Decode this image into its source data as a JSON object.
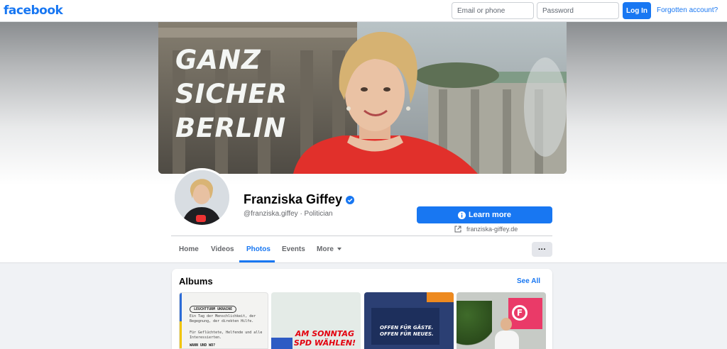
{
  "header": {
    "logo": "facebook",
    "email_placeholder": "Email or phone",
    "password_placeholder": "Password",
    "login_label": "Log In",
    "forgot_label": "Forgotten account?"
  },
  "cover": {
    "slogan_lines": [
      "GANZ",
      "SICHER",
      "BERLIN"
    ]
  },
  "profile": {
    "name": "Franziska Giffey",
    "verified": true,
    "handle_line": "@franziska.giffey · Politician",
    "cta_label": "Learn more",
    "website": "franziska-giffey.de"
  },
  "tabs": [
    {
      "label": "Home",
      "active": false
    },
    {
      "label": "Videos",
      "active": false
    },
    {
      "label": "Photos",
      "active": true
    },
    {
      "label": "Events",
      "active": false
    },
    {
      "label": "More",
      "active": false
    }
  ],
  "more_button_label": "···",
  "albums": {
    "title": "Albums",
    "see_all_label": "See All",
    "thumbs": [
      {
        "pill": "LEUCHTTURM UKRAINE",
        "text1": "Ein Tag der Menschlichkeit, der Begegnung, der direkten Hilfe.",
        "text2": "Für Geflüchtete, Helfende und alle Interessierten.",
        "text3": "WANN UND WO?"
      },
      {
        "text_line1": "AM SONNTAG",
        "text_line2": "SPD WÄHLEN!"
      },
      {
        "text_line1": "OFFEN FÜR GÄSTE.",
        "text_line2": "OFFEN FÜR NEUES."
      },
      {
        "logo_letter": "F"
      }
    ]
  },
  "colors": {
    "brand_blue": "#1877f2",
    "page_bg": "#f0f2f5",
    "slogan": "#f4f6f4",
    "spd_red": "#e3000f"
  }
}
